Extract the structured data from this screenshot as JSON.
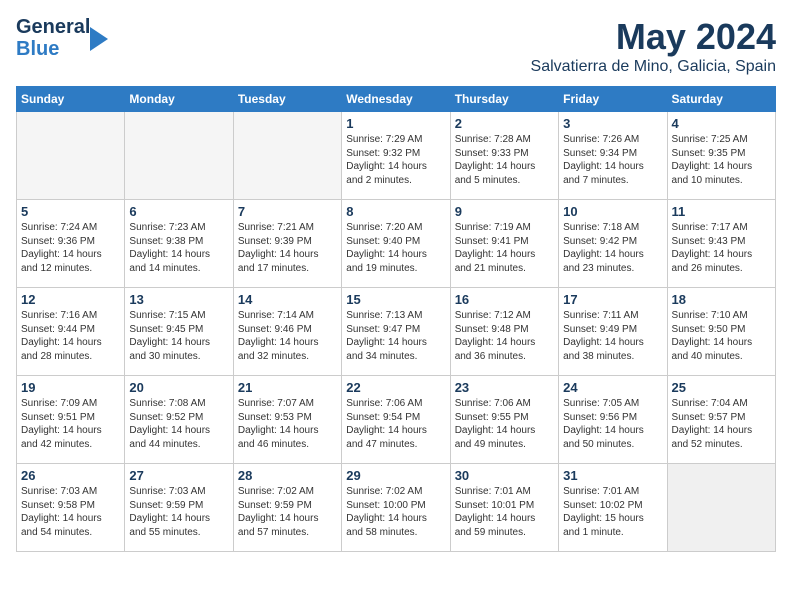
{
  "header": {
    "logo_general": "General",
    "logo_blue": "Blue",
    "month": "May 2024",
    "location": "Salvatierra de Mino, Galicia, Spain"
  },
  "days_of_week": [
    "Sunday",
    "Monday",
    "Tuesday",
    "Wednesday",
    "Thursday",
    "Friday",
    "Saturday"
  ],
  "weeks": [
    {
      "days": [
        {
          "num": "",
          "empty": true
        },
        {
          "num": "",
          "empty": true
        },
        {
          "num": "",
          "empty": true
        },
        {
          "num": "1",
          "sunrise": "7:29 AM",
          "sunset": "9:32 PM",
          "daylight": "14 hours and 2 minutes."
        },
        {
          "num": "2",
          "sunrise": "7:28 AM",
          "sunset": "9:33 PM",
          "daylight": "14 hours and 5 minutes."
        },
        {
          "num": "3",
          "sunrise": "7:26 AM",
          "sunset": "9:34 PM",
          "daylight": "14 hours and 7 minutes."
        },
        {
          "num": "4",
          "sunrise": "7:25 AM",
          "sunset": "9:35 PM",
          "daylight": "14 hours and 10 minutes."
        }
      ]
    },
    {
      "days": [
        {
          "num": "5",
          "sunrise": "7:24 AM",
          "sunset": "9:36 PM",
          "daylight": "14 hours and 12 minutes."
        },
        {
          "num": "6",
          "sunrise": "7:23 AM",
          "sunset": "9:38 PM",
          "daylight": "14 hours and 14 minutes."
        },
        {
          "num": "7",
          "sunrise": "7:21 AM",
          "sunset": "9:39 PM",
          "daylight": "14 hours and 17 minutes."
        },
        {
          "num": "8",
          "sunrise": "7:20 AM",
          "sunset": "9:40 PM",
          "daylight": "14 hours and 19 minutes."
        },
        {
          "num": "9",
          "sunrise": "7:19 AM",
          "sunset": "9:41 PM",
          "daylight": "14 hours and 21 minutes."
        },
        {
          "num": "10",
          "sunrise": "7:18 AM",
          "sunset": "9:42 PM",
          "daylight": "14 hours and 23 minutes."
        },
        {
          "num": "11",
          "sunrise": "7:17 AM",
          "sunset": "9:43 PM",
          "daylight": "14 hours and 26 minutes."
        }
      ]
    },
    {
      "days": [
        {
          "num": "12",
          "sunrise": "7:16 AM",
          "sunset": "9:44 PM",
          "daylight": "14 hours and 28 minutes."
        },
        {
          "num": "13",
          "sunrise": "7:15 AM",
          "sunset": "9:45 PM",
          "daylight": "14 hours and 30 minutes."
        },
        {
          "num": "14",
          "sunrise": "7:14 AM",
          "sunset": "9:46 PM",
          "daylight": "14 hours and 32 minutes."
        },
        {
          "num": "15",
          "sunrise": "7:13 AM",
          "sunset": "9:47 PM",
          "daylight": "14 hours and 34 minutes."
        },
        {
          "num": "16",
          "sunrise": "7:12 AM",
          "sunset": "9:48 PM",
          "daylight": "14 hours and 36 minutes."
        },
        {
          "num": "17",
          "sunrise": "7:11 AM",
          "sunset": "9:49 PM",
          "daylight": "14 hours and 38 minutes."
        },
        {
          "num": "18",
          "sunrise": "7:10 AM",
          "sunset": "9:50 PM",
          "daylight": "14 hours and 40 minutes."
        }
      ]
    },
    {
      "days": [
        {
          "num": "19",
          "sunrise": "7:09 AM",
          "sunset": "9:51 PM",
          "daylight": "14 hours and 42 minutes."
        },
        {
          "num": "20",
          "sunrise": "7:08 AM",
          "sunset": "9:52 PM",
          "daylight": "14 hours and 44 minutes."
        },
        {
          "num": "21",
          "sunrise": "7:07 AM",
          "sunset": "9:53 PM",
          "daylight": "14 hours and 46 minutes."
        },
        {
          "num": "22",
          "sunrise": "7:06 AM",
          "sunset": "9:54 PM",
          "daylight": "14 hours and 47 minutes."
        },
        {
          "num": "23",
          "sunrise": "7:06 AM",
          "sunset": "9:55 PM",
          "daylight": "14 hours and 49 minutes."
        },
        {
          "num": "24",
          "sunrise": "7:05 AM",
          "sunset": "9:56 PM",
          "daylight": "14 hours and 50 minutes."
        },
        {
          "num": "25",
          "sunrise": "7:04 AM",
          "sunset": "9:57 PM",
          "daylight": "14 hours and 52 minutes."
        }
      ]
    },
    {
      "days": [
        {
          "num": "26",
          "sunrise": "7:03 AM",
          "sunset": "9:58 PM",
          "daylight": "14 hours and 54 minutes."
        },
        {
          "num": "27",
          "sunrise": "7:03 AM",
          "sunset": "9:59 PM",
          "daylight": "14 hours and 55 minutes."
        },
        {
          "num": "28",
          "sunrise": "7:02 AM",
          "sunset": "9:59 PM",
          "daylight": "14 hours and 57 minutes."
        },
        {
          "num": "29",
          "sunrise": "7:02 AM",
          "sunset": "10:00 PM",
          "daylight": "14 hours and 58 minutes."
        },
        {
          "num": "30",
          "sunrise": "7:01 AM",
          "sunset": "10:01 PM",
          "daylight": "14 hours and 59 minutes."
        },
        {
          "num": "31",
          "sunrise": "7:01 AM",
          "sunset": "10:02 PM",
          "daylight": "15 hours and 1 minute."
        },
        {
          "num": "",
          "empty": true,
          "shaded": true
        }
      ]
    }
  ],
  "labels": {
    "sunrise_prefix": "Sunrise: ",
    "sunset_prefix": "Sunset: ",
    "daylight_prefix": "Daylight: "
  }
}
